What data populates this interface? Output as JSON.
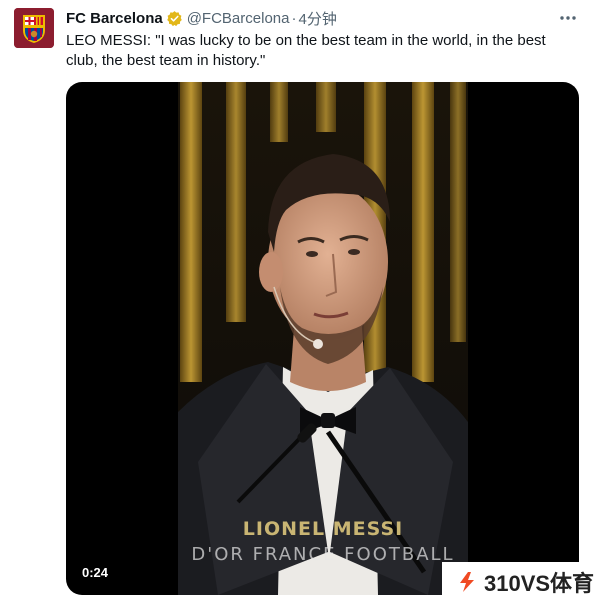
{
  "tweet": {
    "display_name": "FC Barcelona",
    "handle": "@FCBarcelona",
    "separator": "·",
    "time": "4分钟",
    "text": "LEO MESSI: \"I was lucky to be on the best team in the world, in the best club, the best team in history.\""
  },
  "icons": {
    "avatar": "fc-barcelona-crest",
    "verified": "verified-badge-icon",
    "more": "more-options-icon",
    "watermark": "310vs-logo-icon"
  },
  "media": {
    "caption_name": "LIONEL MESSI",
    "caption_sub": "D'OR FRANCE FOOTBALL",
    "duration": "0:24"
  },
  "watermark": {
    "text": "310VS体育"
  },
  "colors": {
    "verified": "#e2b719",
    "crest_red": "#a50044",
    "crest_blue": "#004d98",
    "crest_gold": "#edbb00",
    "curtain_gold": "#c9a227"
  }
}
